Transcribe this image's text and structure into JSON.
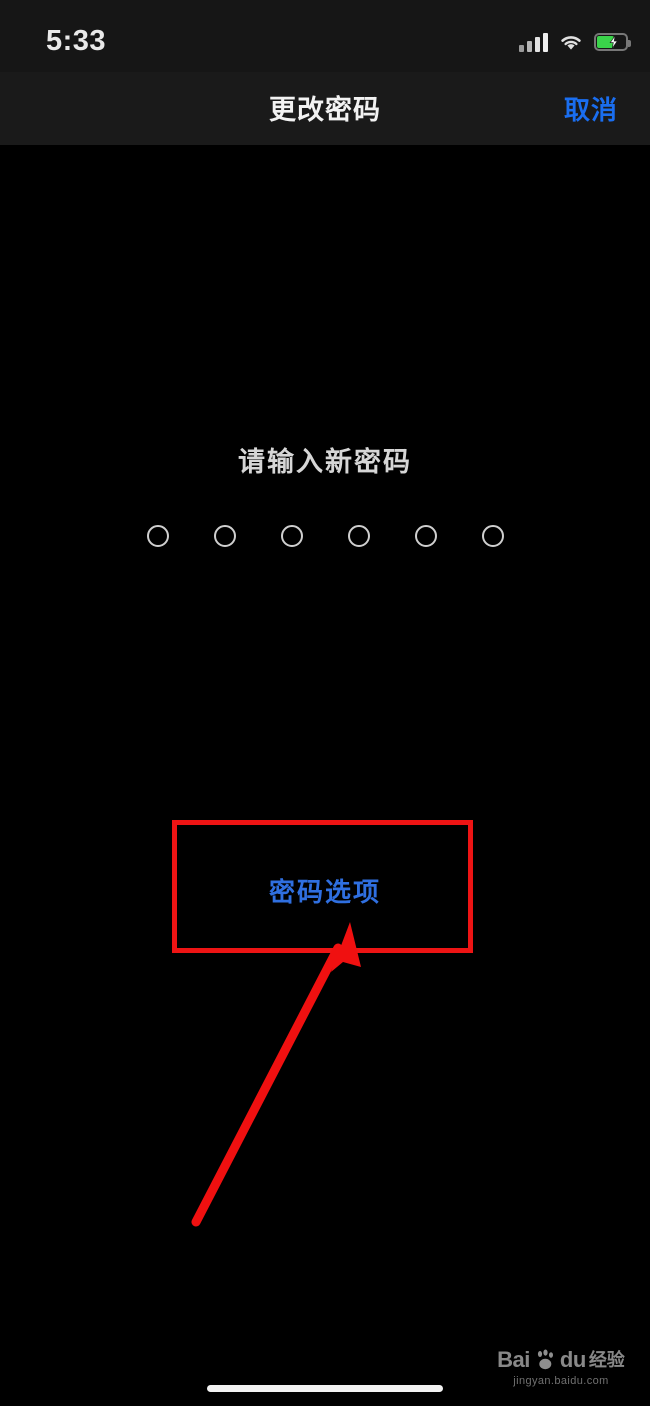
{
  "status_bar": {
    "time": "5:33",
    "signal_icon": "cellular-signal-icon",
    "wifi_icon": "wifi-icon",
    "battery_icon": "battery-charging-icon",
    "battery_color": "#3ad34a"
  },
  "nav_bar": {
    "title": "更改密码",
    "cancel_label": "取消",
    "cancel_color": "#1a6ef0"
  },
  "main": {
    "prompt": "请输入新密码",
    "passcode_dots_count": 6,
    "passcode_dots_filled": 0,
    "passcode_options_label": "密码选项",
    "passcode_options_color": "#2f6fe0"
  },
  "annotation": {
    "highlight_color": "#ee1414",
    "highlight_target": "密码选项",
    "arrow_color": "#f01010"
  },
  "watermark": {
    "brand": "Bai",
    "brand_suffix": "du",
    "sub_brand": "经验",
    "url": "jingyan.baidu.com"
  },
  "home_indicator": {
    "label": "home-indicator"
  }
}
